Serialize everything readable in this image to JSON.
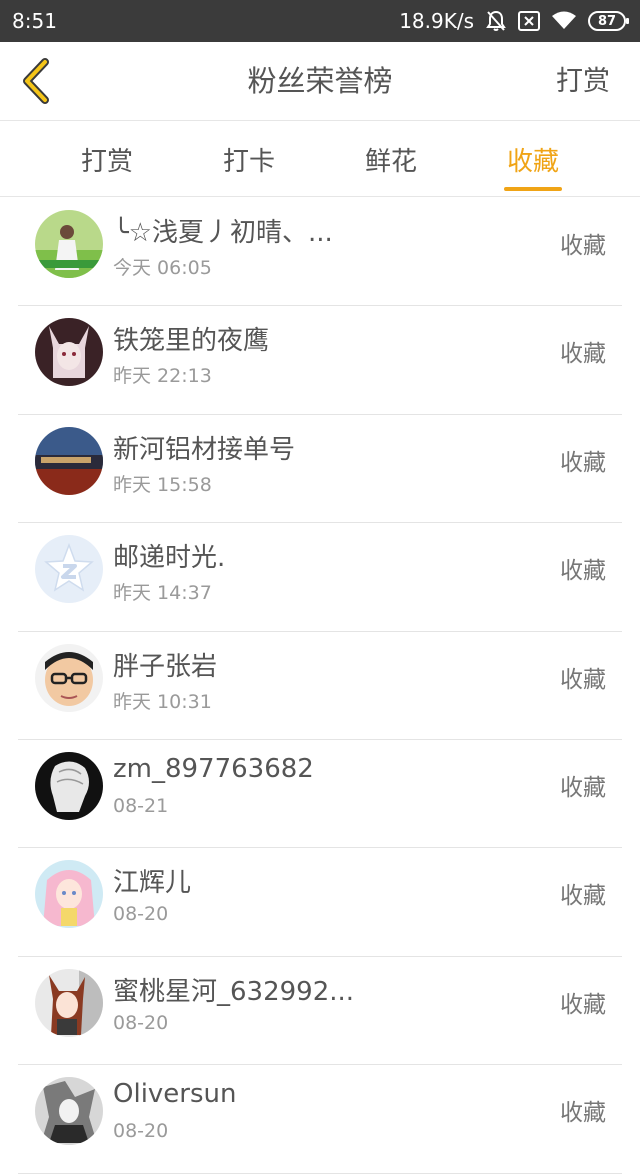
{
  "status_bar": {
    "time": "8:51",
    "net_speed": "18.9K/s",
    "battery": "87",
    "icons": [
      "mute-bell-icon",
      "sim-x-icon",
      "wifi-icon",
      "battery-icon"
    ]
  },
  "nav": {
    "back_icon": "chevron-left-icon",
    "title": "粉丝荣誉榜",
    "action": "打赏"
  },
  "tabs": [
    {
      "label": "打赏",
      "active": false
    },
    {
      "label": "打卡",
      "active": false
    },
    {
      "label": "鲜花",
      "active": false
    },
    {
      "label": "收藏",
      "active": true
    }
  ],
  "colors": {
    "accent": "#f0a416",
    "status_bar": "#3b3b3b",
    "text": "#555555",
    "subtext": "#9a9a9a",
    "divider": "#e4e4e4"
  },
  "fans": [
    {
      "name": "╰☆浅夏丿初晴、...",
      "time": "今天 06:05",
      "tag": "收藏"
    },
    {
      "name": "铁笼里的夜鹰",
      "time": "昨天 22:13",
      "tag": "收藏"
    },
    {
      "name": "新河铝材接单号",
      "time": "昨天 15:58",
      "tag": "收藏"
    },
    {
      "name": "邮递时光.",
      "time": "昨天 14:37",
      "tag": "收藏"
    },
    {
      "name": "胖子张岩",
      "time": "昨天 10:31",
      "tag": "收藏"
    },
    {
      "name": "zm_897763682",
      "time": "08-21",
      "tag": "收藏"
    },
    {
      "name": "江辉儿",
      "time": "08-20",
      "tag": "收藏"
    },
    {
      "name": "蜜桃星河_632992...",
      "time": "08-20",
      "tag": "收藏"
    },
    {
      "name": "Oliversun",
      "time": "08-20",
      "tag": "收藏"
    }
  ]
}
